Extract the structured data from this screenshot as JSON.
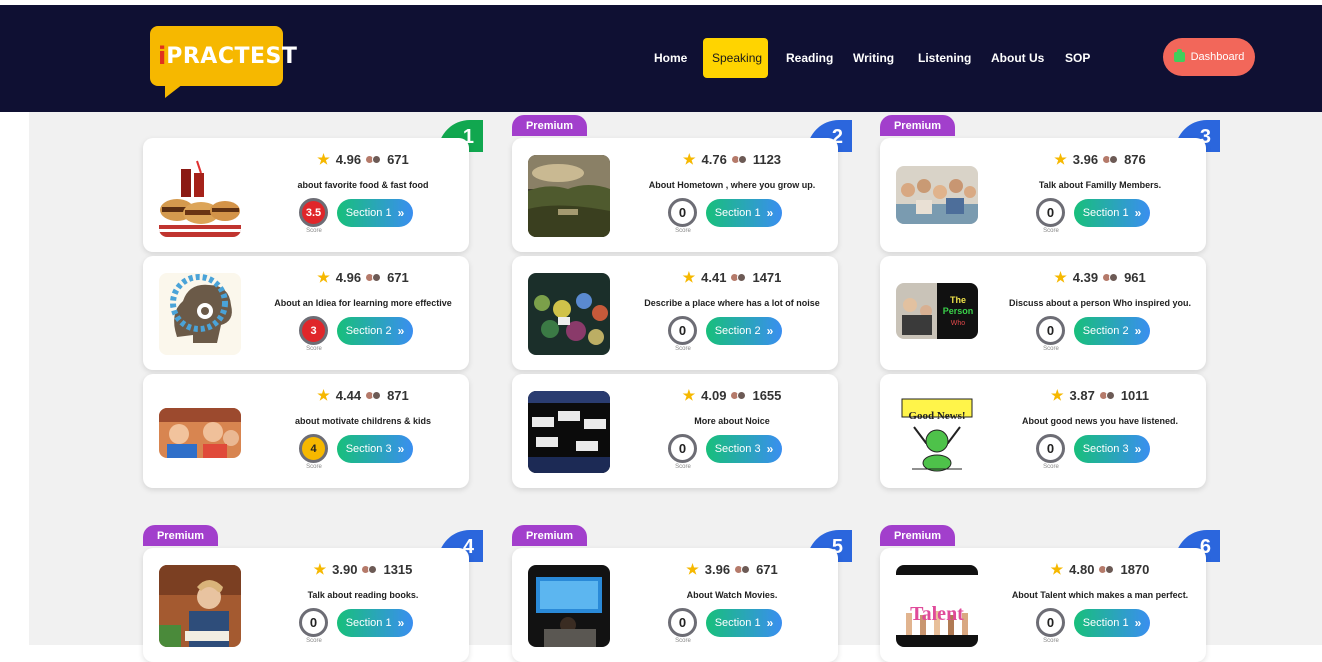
{
  "brand": {
    "logo_i": "i",
    "logo_text": "PRACTEST"
  },
  "nav": {
    "items": [
      {
        "label": "Home"
      },
      {
        "label": "Speaking",
        "active": true
      },
      {
        "label": "Reading"
      },
      {
        "label": "Writing"
      },
      {
        "label": "Listening"
      },
      {
        "label": "About Us"
      },
      {
        "label": "SOP"
      }
    ],
    "dashboard_label": "Dashboard"
  },
  "colors": {
    "navbar": "#0f1033",
    "accent_yellow": "#ffd400",
    "dashboard": "#f2675a",
    "premium": "#a23fcc",
    "badge_green": "#11a74f",
    "badge_blue": "#2b66dd",
    "score_red": "#e0262a",
    "score_yellow": "#f6b800"
  },
  "premium_label": "Premium",
  "score_label": "Score",
  "groups": [
    {
      "number": "1",
      "premium": false,
      "badge_color": "green",
      "cards": [
        {
          "rating": "4.96",
          "count": "671",
          "topic": "about favorite food & fast food",
          "score": "3.5",
          "score_style": "red",
          "section": "Section 1",
          "thumb_icon": "fast-food-image"
        },
        {
          "rating": "4.96",
          "count": "671",
          "topic": "About an Idiea for learning more effective",
          "score": "3",
          "score_style": "red",
          "section": "Section 2",
          "thumb_icon": "brain-gears-image"
        },
        {
          "rating": "4.44",
          "count": "871",
          "topic": "about motivate childrens & kids",
          "score": "4",
          "score_style": "yellow",
          "section": "Section 3",
          "thumb_icon": "kids-reading-image"
        }
      ]
    },
    {
      "number": "2",
      "premium": true,
      "badge_color": "blue",
      "cards": [
        {
          "rating": "4.76",
          "count": "1123",
          "topic": "About Hometown , where you grow up.",
          "score": "0",
          "score_style": "plain",
          "section": "Section 1",
          "thumb_icon": "hometown-landscape-image"
        },
        {
          "rating": "4.41",
          "count": "1471",
          "topic": "Describe a place where has a lot of noise",
          "score": "0",
          "score_style": "plain",
          "section": "Section 2",
          "thumb_icon": "noisy-crowd-image"
        },
        {
          "rating": "4.09",
          "count": "1655",
          "topic": "More about Noice",
          "score": "0",
          "score_style": "plain",
          "section": "Section 3",
          "thumb_icon": "noise-protest-image"
        }
      ]
    },
    {
      "number": "3",
      "premium": true,
      "badge_color": "blue",
      "cards": [
        {
          "rating": "3.96",
          "count": "876",
          "topic": "Talk about Familly Members.",
          "score": "0",
          "score_style": "plain",
          "section": "Section 1",
          "thumb_icon": "family-photo-image"
        },
        {
          "rating": "4.39",
          "count": "961",
          "topic": "Discuss about a person Who inspired you.",
          "score": "0",
          "score_style": "plain",
          "section": "Section 2",
          "thumb_icon": "inspiring-person-image"
        },
        {
          "rating": "3.87",
          "count": "1011",
          "topic": "About good news you have listened.",
          "score": "0",
          "score_style": "plain",
          "section": "Section 3",
          "thumb_icon": "good-news-cartoon-image",
          "thumb_text": "Good News!"
        }
      ]
    },
    {
      "number": "4",
      "premium": true,
      "badge_color": "blue",
      "cards": [
        {
          "rating": "3.90",
          "count": "1315",
          "topic": "Talk about reading books.",
          "score": "0",
          "score_style": "plain",
          "section": "Section 1",
          "thumb_icon": "reading-books-image"
        }
      ]
    },
    {
      "number": "5",
      "premium": true,
      "badge_color": "blue",
      "cards": [
        {
          "rating": "3.96",
          "count": "671",
          "topic": "About Watch Movies.",
          "score": "0",
          "score_style": "plain",
          "section": "Section 1",
          "thumb_icon": "watching-tv-image"
        }
      ]
    },
    {
      "number": "6",
      "premium": true,
      "badge_color": "blue",
      "cards": [
        {
          "rating": "4.80",
          "count": "1870",
          "topic": "About Talent which makes a man perfect.",
          "score": "0",
          "score_style": "plain",
          "section": "Section 1",
          "thumb_icon": "talent-hands-image",
          "thumb_text": "Talent"
        }
      ]
    }
  ]
}
